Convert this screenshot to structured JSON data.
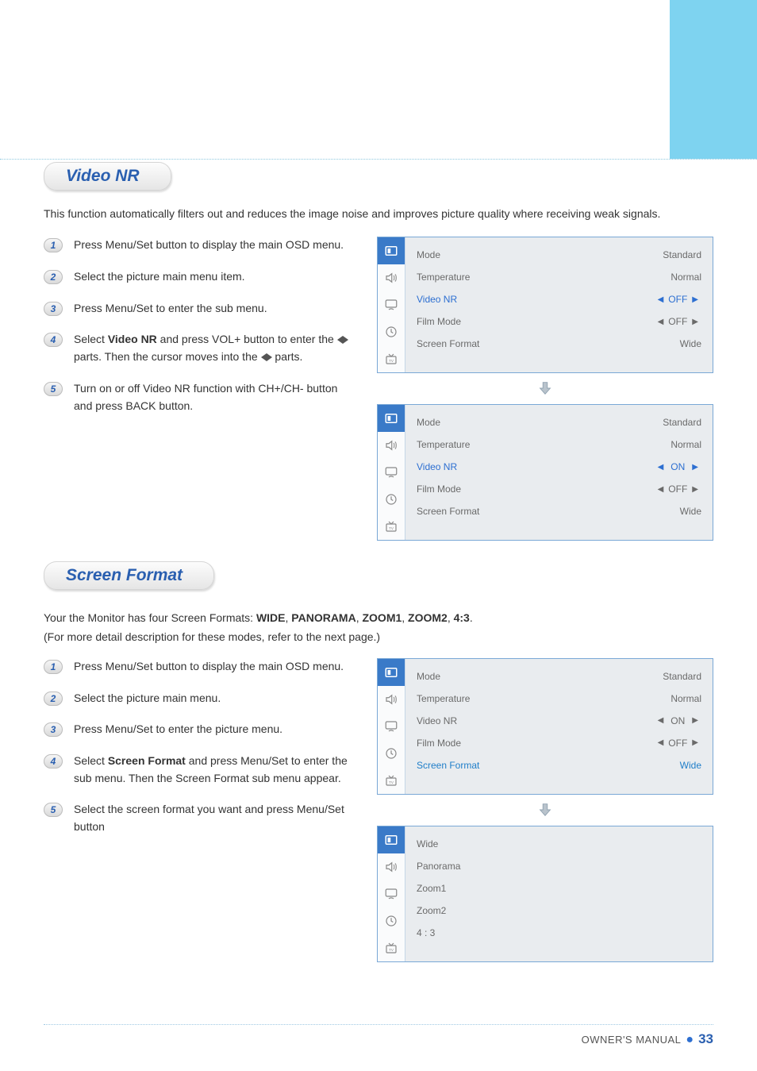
{
  "header_sections": {
    "videoNR": {
      "title": "Video NR",
      "intro": "This function automatically filters out and reduces the image noise and improves picture quality where receiving weak signals."
    },
    "screenFormat": {
      "title": "Screen Format",
      "intro_pre": "Your the Monitor has four Screen Formats: ",
      "formats": [
        "WIDE",
        "PANORAMA",
        "ZOOM1",
        "ZOOM2",
        "4:3"
      ],
      "intro_post": "(For more detail description for these modes, refer to the next page.)"
    }
  },
  "steps_videoNR": [
    "Press Menu/Set button to display the main OSD menu.",
    "Select the picture main menu item.",
    "Press Menu/Set to enter the sub menu.",
    {
      "pre": "Select ",
      "bold": "Video NR",
      "mid": " and press VOL+ button to enter the ",
      "arrows": true,
      "post1": " parts. Then the cursor moves into the ",
      "post2": " parts."
    },
    "Turn on or off Video NR function with CH+/CH- button and press BACK button."
  ],
  "steps_screenFormat": [
    "Press Menu/Set button to display the main OSD menu.",
    "Select the picture main menu.",
    "Press Menu/Set to enter the picture menu.",
    {
      "pre": "Select ",
      "bold": "Screen Format",
      "post": " and press Menu/Set to enter the sub menu. Then the Screen Format sub menu appear."
    },
    "Select the screen format you want and press Menu/Set button"
  ],
  "osd": {
    "labels": {
      "mode": "Mode",
      "temperature": "Temperature",
      "videoNR": "Video NR",
      "filmMode": "Film Mode",
      "screenFormat": "Screen Format"
    },
    "panel_vnr_off": {
      "mode": "Standard",
      "temperature": "Normal",
      "videoNR": "OFF",
      "filmMode": "OFF",
      "screenFormat": "Wide",
      "highlight": "videoNR"
    },
    "panel_vnr_on": {
      "mode": "Standard",
      "temperature": "Normal",
      "videoNR": "ON",
      "filmMode": "OFF",
      "screenFormat": "Wide",
      "highlight": "videoNR"
    },
    "panel_sf": {
      "mode": "Standard",
      "temperature": "Normal",
      "videoNR": "ON",
      "filmMode": "OFF",
      "screenFormat": "Wide",
      "highlight": "screenFormat"
    },
    "sf_options": [
      "Wide",
      "Panorama",
      "Zoom1",
      "Zoom2",
      "4 : 3"
    ]
  },
  "footer": {
    "label": "OWNER'S MANUAL",
    "page": "33"
  }
}
